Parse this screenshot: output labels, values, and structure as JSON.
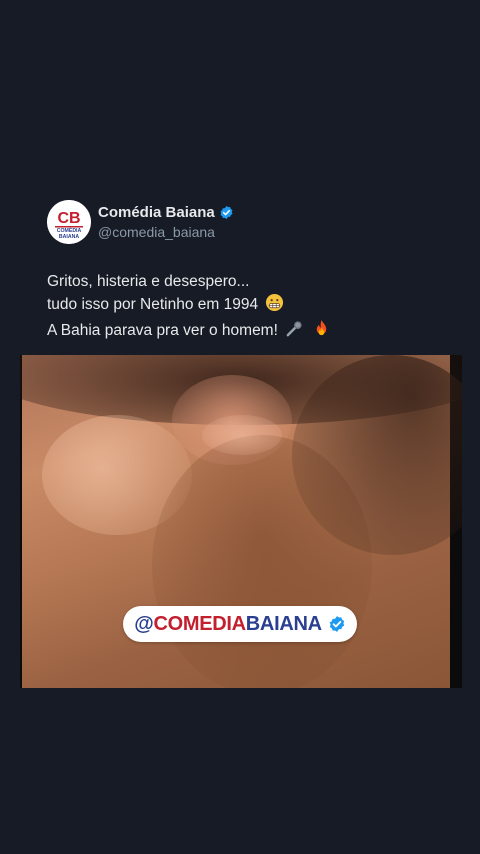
{
  "account": {
    "display_name": "Comédia Baiana",
    "handle": "@comedia_baiana",
    "avatar_initials": "CB",
    "avatar_sub1": "COMÉDIA",
    "avatar_sub2": "BAIANA",
    "verified_color": "#1d9bf0"
  },
  "tweet": {
    "line1": "Gritos, histeria e desespero...",
    "line2": "tudo isso por Netinho em 1994",
    "line3": "A Bahia parava pra ver o homem!",
    "emojis": [
      "grimacing-face-icon",
      "microphone-icon",
      "fire-icon"
    ]
  },
  "watermark": {
    "at": "@",
    "part1": "COMEDIA",
    "part2": "BAIANA",
    "colors": {
      "blue": "#2a3f8f",
      "red": "#c2202f"
    }
  },
  "colors": {
    "background": "#161b26",
    "text": "#e7e9ea",
    "muted": "#8b98a5"
  }
}
